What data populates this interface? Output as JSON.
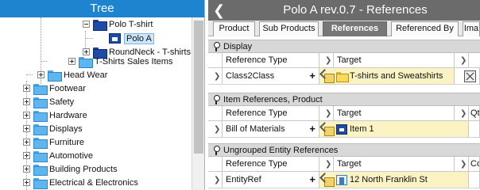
{
  "tree": {
    "title": "Tree",
    "rows": [
      {
        "label": "Polo T-shirt"
      },
      {
        "label": "Polo A"
      },
      {
        "label": "RoundNeck - T-shirts"
      },
      {
        "label": "T-Shirts Sales Items"
      },
      {
        "label": "Head Wear"
      },
      {
        "label": "Footwear"
      },
      {
        "label": "Safety"
      },
      {
        "label": "Hardware"
      },
      {
        "label": "Displays"
      },
      {
        "label": "Furniture"
      },
      {
        "label": "Automotive"
      },
      {
        "label": "Building Products"
      },
      {
        "label": "Electrical & Electronics"
      }
    ]
  },
  "detail": {
    "title": "Polo A rev.0.7 - References",
    "back_icon": "chevron-left-icon",
    "tabs": [
      {
        "label": "Product"
      },
      {
        "label": "Sub Products"
      },
      {
        "label": "References",
        "active": true
      },
      {
        "label": "Referenced By"
      },
      {
        "label": "Ima"
      }
    ],
    "sections": [
      {
        "title": "Display",
        "col_reftype": "Reference Type",
        "col_target": "Target",
        "row": {
          "reftype": "Class2Class",
          "target": "T-shirts and Sweatshirts"
        }
      },
      {
        "title": "Item References, Product",
        "col_reftype": "Reference Type",
        "col_target": "Target",
        "col_extra": "Qty",
        "row": {
          "reftype": "Bill of Materials",
          "target": "Item 1"
        }
      },
      {
        "title": "Ungrouped Entity References",
        "col_reftype": "Reference Type",
        "col_target": "Target",
        "col_extra": "Co",
        "row": {
          "reftype": "EntityRef",
          "target": "12 North Franklin St"
        }
      }
    ]
  }
}
